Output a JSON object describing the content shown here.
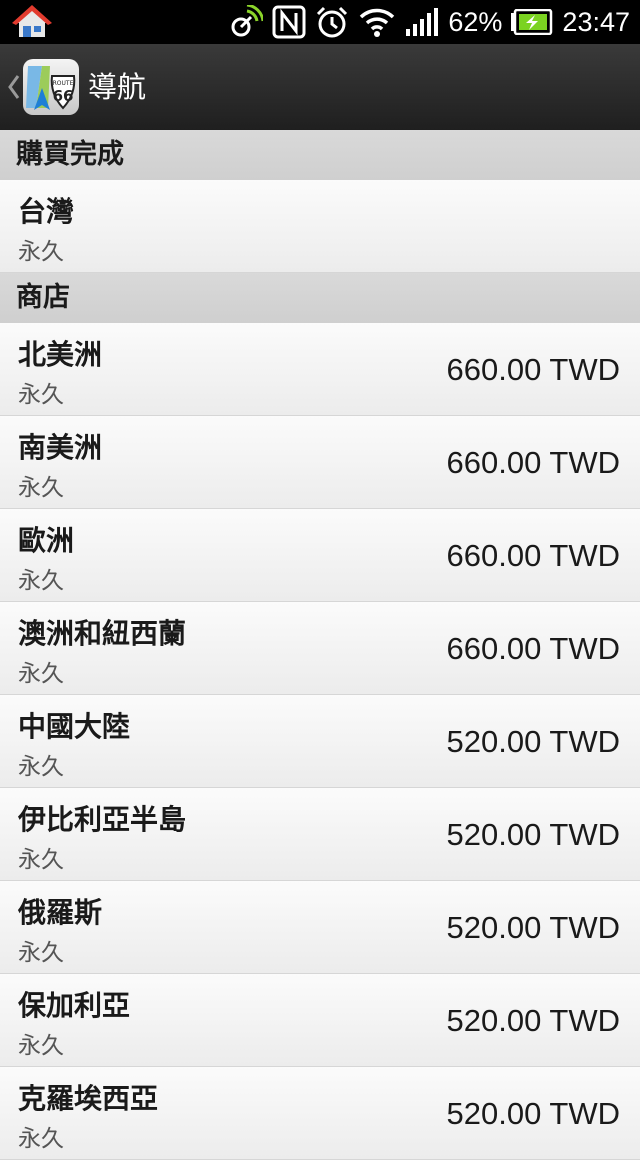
{
  "status_bar": {
    "battery_percent": "62%",
    "time": "23:47",
    "icons": [
      "home-icon",
      "gps-signal-icon",
      "nfc-icon",
      "alarm-icon",
      "wifi-icon",
      "cell-signal-icon",
      "battery-charging-icon"
    ]
  },
  "action_bar": {
    "title": "導航",
    "app_icon": "route-66-navigation-icon"
  },
  "sections": {
    "purchased": {
      "header": "購買完成",
      "items": [
        {
          "title": "台灣",
          "subtitle": "永久"
        }
      ]
    },
    "store": {
      "header": "商店",
      "items": [
        {
          "title": "北美洲",
          "subtitle": "永久",
          "price": "660.00 TWD"
        },
        {
          "title": "南美洲",
          "subtitle": "永久",
          "price": "660.00 TWD"
        },
        {
          "title": "歐洲",
          "subtitle": "永久",
          "price": "660.00 TWD"
        },
        {
          "title": "澳洲和紐西蘭",
          "subtitle": "永久",
          "price": "660.00 TWD"
        },
        {
          "title": "中國大陸",
          "subtitle": "永久",
          "price": "520.00 TWD"
        },
        {
          "title": "伊比利亞半島",
          "subtitle": "永久",
          "price": "520.00 TWD"
        },
        {
          "title": "俄羅斯",
          "subtitle": "永久",
          "price": "520.00 TWD"
        },
        {
          "title": "保加利亞",
          "subtitle": "永久",
          "price": "520.00 TWD"
        },
        {
          "title": "克羅埃西亞",
          "subtitle": "永久",
          "price": "520.00 TWD"
        }
      ]
    }
  },
  "colors": {
    "status_bar_bg": "#000000",
    "action_bar_bg": "#2b2b2b",
    "section_header_bg": "#d4d4d4",
    "row_bg": "#f4f4f4",
    "charging_green": "#7bd321"
  }
}
